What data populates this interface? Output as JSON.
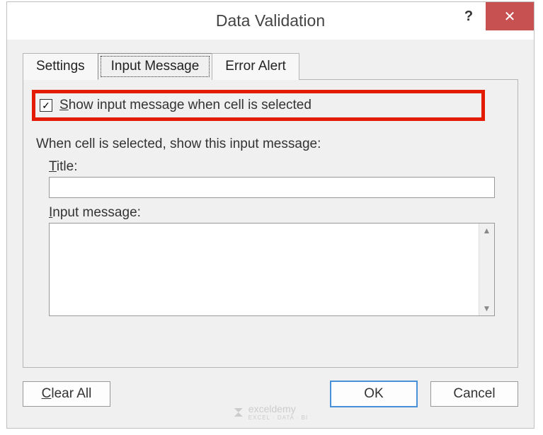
{
  "titlebar": {
    "title": "Data Validation",
    "help_glyph": "?",
    "close_glyph": "✕"
  },
  "tabs": {
    "settings": "Settings",
    "input_message": "Input Message",
    "error_alert": "Error Alert"
  },
  "panel": {
    "checkbox_checked": true,
    "checkbox_glyph": "✓",
    "checkbox_label_prefix": "S",
    "checkbox_label_rest": "how input message when cell is selected",
    "section_heading": "When cell is selected, show this input message:",
    "title_label_prefix": "T",
    "title_label_rest": "itle:",
    "title_value": "",
    "message_label_prefix": "I",
    "message_label_rest": "nput message:",
    "message_value": ""
  },
  "buttons": {
    "clear_prefix": "C",
    "clear_rest": "lear All",
    "ok": "OK",
    "cancel": "Cancel"
  },
  "watermark": {
    "brand": "exceldemy",
    "sub": "EXCEL · DATA · BI"
  }
}
